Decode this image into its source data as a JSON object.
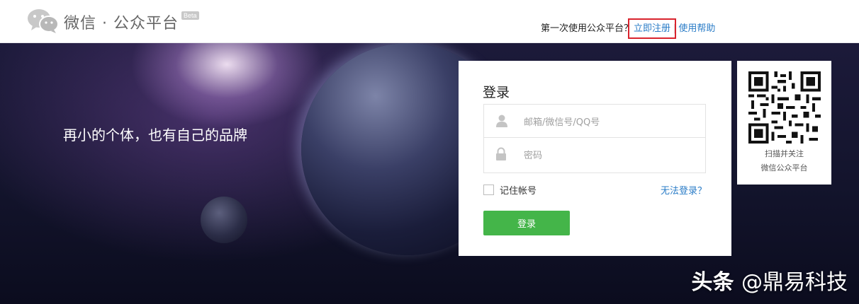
{
  "header": {
    "brand": "微信 · 公众平台",
    "badge": "Beta",
    "first_time_text": "第一次使用公众平台？",
    "register_link": "立即注册",
    "separator": "|",
    "help_link": "使用帮助"
  },
  "hero": {
    "slogan": "再小的个体，也有自己的品牌"
  },
  "login": {
    "title": "登录",
    "account_placeholder": "邮箱/微信号/QQ号",
    "password_placeholder": "密码",
    "remember_label": "记住帐号",
    "forgot_link": "无法登录？",
    "submit_label": "登录"
  },
  "qr": {
    "line1": "扫描并关注",
    "line2": "微信公众平台"
  },
  "watermark": {
    "prefix": "头条",
    "handle": "@鼎易科技"
  },
  "colors": {
    "link": "#2a7cc7",
    "button": "#44b549",
    "highlight": "#d9232d"
  }
}
